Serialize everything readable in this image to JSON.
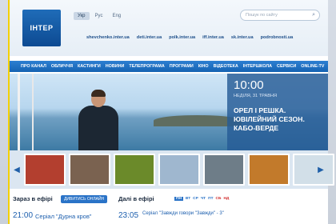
{
  "header": {
    "logo_text": "ІНТЕР",
    "languages": [
      {
        "label": "Укр",
        "active": true
      },
      {
        "label": "Рус",
        "active": false
      },
      {
        "label": "Eng",
        "active": false
      }
    ],
    "search_placeholder": "Пошук по сайту",
    "sublinks": [
      "shevchenko.inter.ua",
      "deti.inter.ua",
      "polk.inter.ua",
      "iff.inter.ua",
      "sk.inter.ua",
      "podrobnosti.ua"
    ]
  },
  "nav": [
    "ПРО КАНАЛ",
    "ОБЛИЧЧЯ",
    "КАСТИНГИ",
    "НОВИНИ",
    "ТЕЛЕПРОГРАМА",
    "ПРОГРАМИ",
    "КІНО",
    "ВІДЕОТЕКА",
    "ІНТЕРШКОЛА",
    "СЕРВІСИ",
    "ONLINE-TV"
  ],
  "hero": {
    "time": "10:00",
    "date": "НЕДІЛЯ, 31 ТРАВНЯ",
    "title": "ОРЕЛ І РЕШКА. ЮВІЛЕЙНИЙ СЕЗОН. КАБО-ВЕРДЕ"
  },
  "thumbs": [
    {
      "name": "thumb-1",
      "color": "#b33f2f"
    },
    {
      "name": "thumb-2",
      "color": "#7a6250"
    },
    {
      "name": "thumb-3",
      "color": "#6b8a2a"
    },
    {
      "name": "thumb-4",
      "color": "#9fb7cf"
    },
    {
      "name": "thumb-5",
      "color": "#6e7d88"
    },
    {
      "name": "thumb-6",
      "color": "#c27a2b"
    },
    {
      "name": "thumb-7",
      "color": "#d2dfe8"
    }
  ],
  "on_air": {
    "now_label": "Зараз в ефірі",
    "watch_button": "ДИВИТИСЬ ОНЛАЙН",
    "now_time": "21:00",
    "now_show": "Серіал \"Дурна кров\"",
    "next_label": "Далі в ефірі",
    "days": [
      {
        "label": "ПН",
        "active": true,
        "weekend": false
      },
      {
        "label": "ВТ",
        "active": false,
        "weekend": false
      },
      {
        "label": "СР",
        "active": false,
        "weekend": false
      },
      {
        "label": "ЧТ",
        "active": false,
        "weekend": false
      },
      {
        "label": "ПТ",
        "active": false,
        "weekend": false
      },
      {
        "label": "СБ",
        "active": false,
        "weekend": true
      },
      {
        "label": "НД",
        "active": false,
        "weekend": true
      }
    ],
    "next_time": "23:05",
    "next_show": "Серіал \"Завжди говори \"Завжди\" - 3\""
  }
}
